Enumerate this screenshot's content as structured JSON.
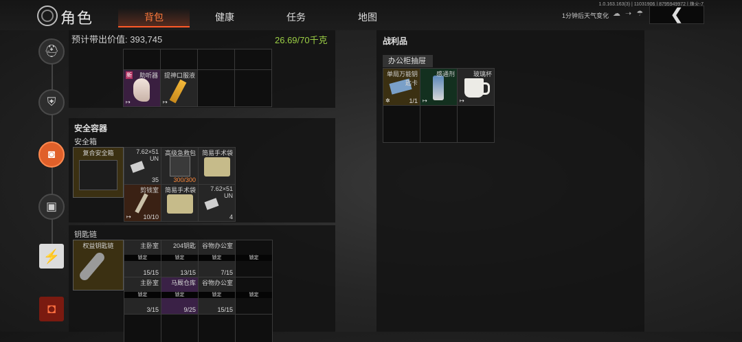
{
  "header": {
    "title": "角色",
    "tabs": [
      "背包",
      "健康",
      "任务",
      "地图"
    ],
    "active_tab": "背包",
    "version": "1.0.163.163(3) | 11031906 | 8795949972 | 烽火-7",
    "weather_label": "1分钟后天气变化",
    "weather_icons": "☁ ➝ ☂",
    "back_glyph": "❮"
  },
  "sidebar": {
    "items": [
      "helmet-icon",
      "armor-icon",
      "backpack-icon",
      "case-icon",
      "skill-icon",
      "bag-icon"
    ],
    "active": "backpack-icon"
  },
  "inventory": {
    "estimated_label": "预计带出价值:",
    "estimated_value": "393,745",
    "weight": "26.69/70千克",
    "items": [
      {
        "name": "助听器",
        "badge": "新",
        "corner": "↦"
      },
      {
        "name": "提神口服液",
        "corner": "↦"
      }
    ]
  },
  "secure": {
    "title": "安全容器",
    "subtitle": "安全箱",
    "container_name": "复合安全箱",
    "items": [
      {
        "name": "7.62×51\nUN",
        "count": "35"
      },
      {
        "name": "高级急救包",
        "count": "300/300"
      },
      {
        "name": "简易手术袋",
        "count": ""
      },
      {
        "name": "剪钱室",
        "count": "10/10",
        "corner": "↦"
      },
      {
        "name": "简易手术袋",
        "count": ""
      },
      {
        "name": "7.62×51\nUN",
        "count": "4"
      }
    ]
  },
  "keychain": {
    "title": "钥匙链",
    "container_name": "权益钥匙链",
    "lock_label": "锁定",
    "rows": [
      [
        {
          "name": "主卧室",
          "count": "15/15"
        },
        {
          "name": "204钥匙",
          "count": "13/15"
        },
        {
          "name": "谷物办公室",
          "count": "7/15"
        },
        {
          "name": "",
          "count": ""
        }
      ],
      [
        {
          "name": "主卧室",
          "count": "3/15"
        },
        {
          "name": "马厩仓库",
          "count": "9/25"
        },
        {
          "name": "谷物办公室",
          "count": "15/15"
        },
        {
          "name": "",
          "count": ""
        }
      ]
    ]
  },
  "loot": {
    "title": "战利品",
    "source": "办公柜抽屉",
    "items": [
      {
        "name": "单局万能钥\n匙卡",
        "count": "1/1",
        "corner": "✲"
      },
      {
        "name": "感通剂",
        "corner": "↦"
      },
      {
        "name": "玻璃杯",
        "corner": "↦"
      }
    ]
  }
}
